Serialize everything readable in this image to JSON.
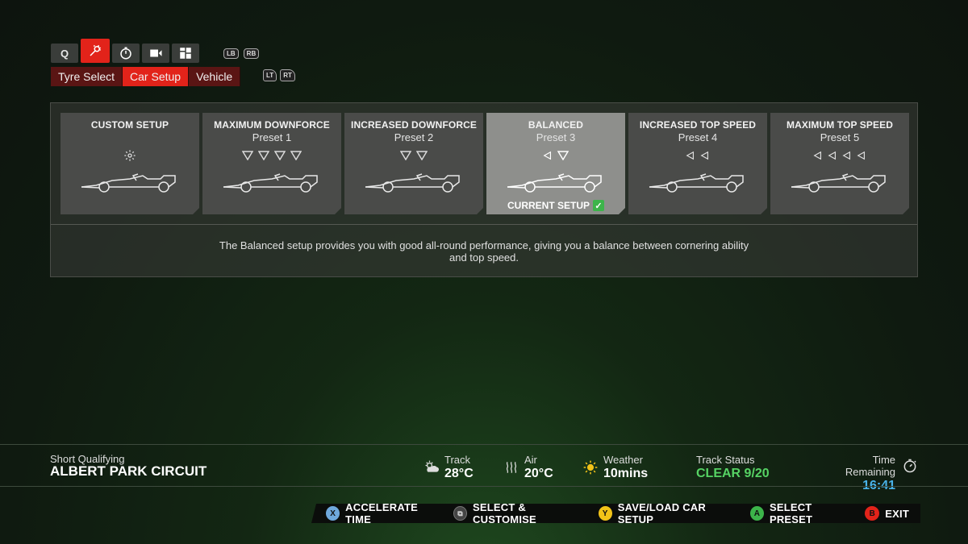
{
  "top_tabs": [
    {
      "icon": "qualifying-icon",
      "label": "Q"
    },
    {
      "icon": "car-setup-wrench-icon",
      "label": ""
    },
    {
      "icon": "stopwatch-icon",
      "label": ""
    },
    {
      "icon": "replay-icon",
      "label": ""
    },
    {
      "icon": "grid-icon",
      "label": ""
    }
  ],
  "bumper_hints": [
    "LB",
    "RB"
  ],
  "sub_tabs": [
    "Tyre Select",
    "Car Setup",
    "Vehicle"
  ],
  "trigger_hints": [
    "LT",
    "RT"
  ],
  "setups": [
    {
      "title": "CUSTOM SETUP",
      "preset": "",
      "icon": "gear-icon"
    },
    {
      "title": "MAXIMUM DOWNFORCE",
      "preset": "Preset 1",
      "icon": "down-arrows-4"
    },
    {
      "title": "INCREASED DOWNFORCE",
      "preset": "Preset 2",
      "icon": "down-arrows-2"
    },
    {
      "title": "BALANCED",
      "preset": "Preset 3",
      "icon": "left-down-arrows"
    },
    {
      "title": "INCREASED TOP SPEED",
      "preset": "Preset 4",
      "icon": "left-arrows-2"
    },
    {
      "title": "MAXIMUM TOP SPEED",
      "preset": "Preset 5",
      "icon": "left-arrows-4"
    }
  ],
  "selected_setup": "BALANCED",
  "current_setup_label": "CURRENT SETUP",
  "description": "The Balanced setup provides you with good all-round performance, giving you a balance between cornering ability and top speed.",
  "session": {
    "type": "Short Qualifying",
    "circuit": "ALBERT PARK CIRCUIT"
  },
  "conditions": {
    "track_label": "Track",
    "track_value": "28°C",
    "air_label": "Air",
    "air_value": "20°C",
    "weather_label": "Weather",
    "weather_value": "10mins",
    "status_label": "Track Status",
    "status_value": "CLEAR 9/20",
    "time_label": "Time Remaining",
    "time_value": "16:41"
  },
  "footer_actions": [
    {
      "button": "X",
      "label": "ACCELERATE TIME",
      "color": "#6fa8dc"
    },
    {
      "button": "view",
      "label": "SELECT & CUSTOMISE",
      "color": "#444444"
    },
    {
      "button": "Y",
      "label": "SAVE/LOAD CAR SETUP",
      "color": "#f2c318"
    },
    {
      "button": "A",
      "label": "SELECT PRESET",
      "color": "#3cb44a"
    },
    {
      "button": "B",
      "label": "EXIT",
      "color": "#e2231a"
    }
  ],
  "colors": {
    "accent_red": "#e2231a",
    "status_green": "#56d364",
    "time_blue": "#49b3ea"
  }
}
